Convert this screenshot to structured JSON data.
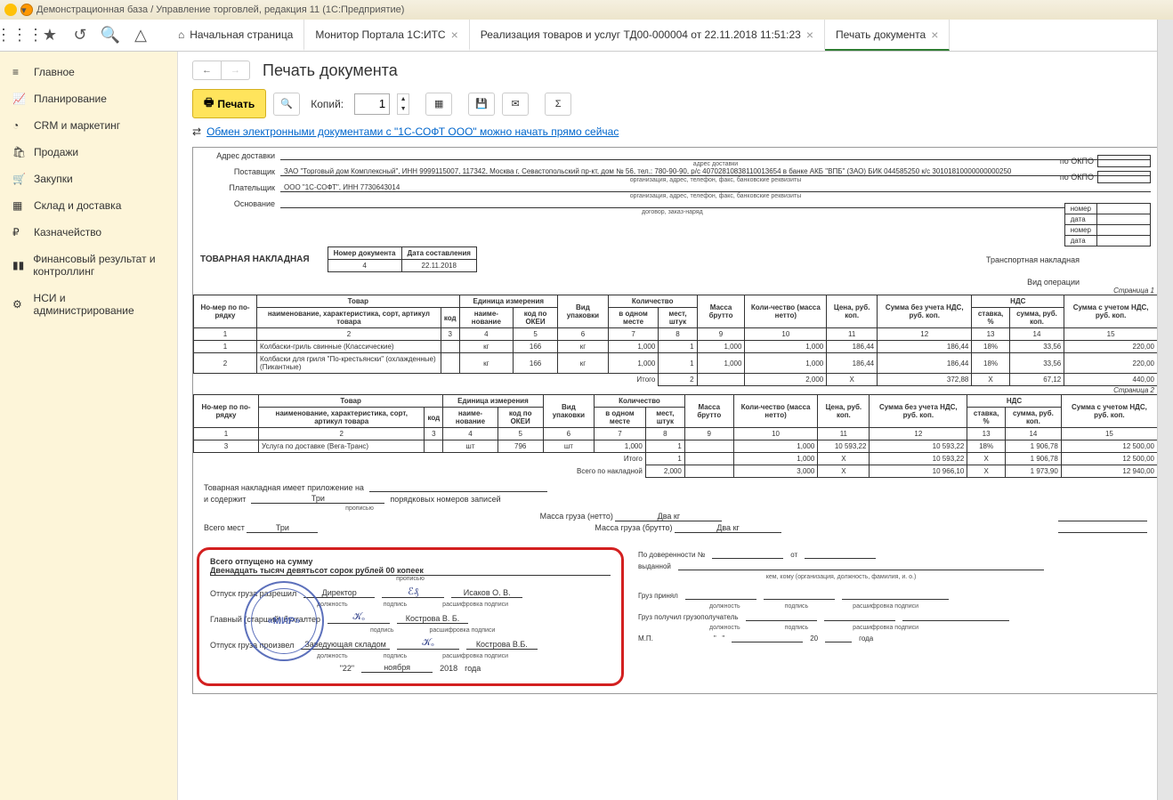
{
  "titlebar": "Демонстрационная база / Управление торговлей, редакция 11  (1С:Предприятие)",
  "tabs": [
    {
      "icon": "home",
      "label": "Начальная страница"
    },
    {
      "label": "Монитор Портала 1С:ИТС",
      "close": true
    },
    {
      "label": "Реализация товаров и услуг ТД00-000004 от 22.11.2018 11:51:23",
      "close": true
    },
    {
      "label": "Печать документа",
      "close": true,
      "active": true
    }
  ],
  "sidebar": [
    {
      "icon": "menu",
      "label": "Главное"
    },
    {
      "icon": "chart",
      "label": "Планирование"
    },
    {
      "icon": "pie",
      "label": "CRM и маркетинг"
    },
    {
      "icon": "bag",
      "label": "Продажи"
    },
    {
      "icon": "cart",
      "label": "Закупки"
    },
    {
      "icon": "grid",
      "label": "Склад и доставка"
    },
    {
      "icon": "coin",
      "label": "Казначейство"
    },
    {
      "icon": "bars",
      "label": "Финансовый результат и контроллинг"
    },
    {
      "icon": "gear",
      "label": "НСИ и администрирование"
    }
  ],
  "page_title": "Печать документа",
  "print_btn": "Печать",
  "copies_label": "Копий:",
  "copies_value": "1",
  "exchange_link": "Обмен электронными документами с \"1С-СОФТ ООО\" можно начать прямо сейчас",
  "doc": {
    "delivery_addr_label": "Адрес доставки",
    "delivery_caption": "адрес доставки",
    "supplier_label": "Поставщик",
    "supplier": "ЗАО \"Торговый дом Комплексный\", ИНН 9999115007, 117342, Москва г, Севастопольский пр-кт, дом № 56, тел.: 780-90-90, р/с 40702810838110013654 в банке АКБ \"ВПБ\" (ЗАО) БИК 044585250 к/с 30101810000000000250",
    "org_caption": "организация, адрес, телефон, факс, банковские реквизиты",
    "payer_label": "Плательщик",
    "payer": "ООО \"1С-СОФТ\", ИНН 7730643014",
    "basis_label": "Основание",
    "basis_caption": "договор, заказ-наряд",
    "okpo": "по ОКПО",
    "side_rows": [
      "номер",
      "дата",
      "номер",
      "дата"
    ],
    "main_title": "ТОВАРНАЯ НАКЛАДНАЯ",
    "doc_num_h": "Номер документа",
    "doc_date_h": "Дата составления",
    "doc_num": "4",
    "doc_date": "22.11.2018",
    "transport": "Транспортная накладная",
    "operation": "Вид операции",
    "page1": "Страница 1",
    "page2": "Страница 2",
    "headers": {
      "no": "Но-мер по по-рядку",
      "goods": "Товар",
      "name": "наименование, характеристика, сорт, артикул товара",
      "code": "код",
      "unit": "Единица измерения",
      "unit_name": "наиме-нование",
      "okei": "код по ОКЕИ",
      "pack": "Вид упаковки",
      "qty": "Количество",
      "in_one": "в одном месте",
      "places": "мест, штук",
      "gross": "Масса брутто",
      "qty_net": "Коли-чество (масса нетто)",
      "price": "Цена, руб. коп.",
      "sum_novat": "Сумма без учета НДС, руб. коп.",
      "vat": "НДС",
      "rate": "ставка, %",
      "vat_sum": "сумма, руб. коп.",
      "sum_vat": "Сумма с учетом НДС, руб. коп."
    },
    "col_nums": [
      "1",
      "2",
      "3",
      "4",
      "5",
      "6",
      "7",
      "8",
      "9",
      "10",
      "11",
      "12",
      "13",
      "14",
      "15"
    ],
    "rows1": [
      {
        "n": "1",
        "name": "Колбаски-гриль свинные (Классические)",
        "code": "",
        "unit": "кг",
        "okei": "166",
        "pack": "кг",
        "in_one": "1,000",
        "places": "1",
        "gross": "1,000",
        "net": "1,000",
        "price": "186,44",
        "sum": "186,44",
        "rate": "18%",
        "vat": "33,56",
        "total": "220,00"
      },
      {
        "n": "2",
        "name": "Колбаски для гриля \"По-крестьянски\" (охлажденные) (Пикантные)",
        "code": "",
        "unit": "кг",
        "okei": "166",
        "pack": "кг",
        "in_one": "1,000",
        "places": "1",
        "gross": "1,000",
        "net": "1,000",
        "price": "186,44",
        "sum": "186,44",
        "rate": "18%",
        "vat": "33,56",
        "total": "220,00"
      }
    ],
    "itogo1": {
      "label": "Итого",
      "places": "2",
      "net": "2,000",
      "price": "X",
      "sum": "372,88",
      "rate": "X",
      "vat": "67,12",
      "total": "440,00"
    },
    "rows2": [
      {
        "n": "3",
        "name": "Услуга по доставке (Вега-Транс)",
        "code": "",
        "unit": "шт",
        "okei": "796",
        "pack": "шт",
        "in_one": "1,000",
        "places": "1",
        "gross": "",
        "net": "1,000",
        "price": "10 593,22",
        "sum": "10 593,22",
        "rate": "18%",
        "vat": "1 906,78",
        "total": "12 500,00"
      }
    ],
    "itogo2": {
      "label": "Итого",
      "places": "1",
      "net": "1,000",
      "price": "X",
      "sum": "10 593,22",
      "rate": "X",
      "vat": "1 906,78",
      "total": "12 500,00"
    },
    "grand": {
      "label": "Всего по накладной",
      "places": "2,000",
      "net": "3,000",
      "price": "X",
      "sum": "10 966,10",
      "rate": "X",
      "vat": "1 973,90",
      "total": "12 940,00"
    },
    "attach": {
      "l1": "Товарная накладная имеет приложение на",
      "l2": "и содержит",
      "three": "Три",
      "records": "порядковых номеров записей",
      "in_words": "прописью",
      "mass_net": "Масса груза (нетто)",
      "mass_gross": "Масса груза (брутто)",
      "two_kg": "Два кг",
      "total_places": "Всего мест"
    },
    "sign": {
      "total_label": "Всего отпущено  на сумму",
      "total_words": "Двенадцать тысяч девятьсот сорок рублей 00 копеек",
      "allow": "Отпуск груза разрешил",
      "director": "Директор",
      "sig1": "Исаков О. В.",
      "chief": "Главный (старший) бухгалтер",
      "sig2": "Кострова В. Б.",
      "made": "Отпуск груза произвел",
      "warehouse": "Заведующая складом",
      "sig3": "Кострова В.Б.",
      "date_d": "\"22\"",
      "date_m": "ноября",
      "date_y": "2018",
      "year": "года",
      "stamp": "«МИР»",
      "caption_pos": "должность",
      "caption_sig": "подпись",
      "caption_dec": "расшифровка подписи"
    },
    "right": {
      "by_warrant": "По доверенности №",
      "from": "от",
      "issued": "выданной",
      "issued_cap": "кем, кому (организация, должность, фамилия, и. о.)",
      "accepted": "Груз принял",
      "received": "Груз получил грузополучатель",
      "mp": "М.П.",
      "y20": "20",
      "year": "года"
    }
  }
}
